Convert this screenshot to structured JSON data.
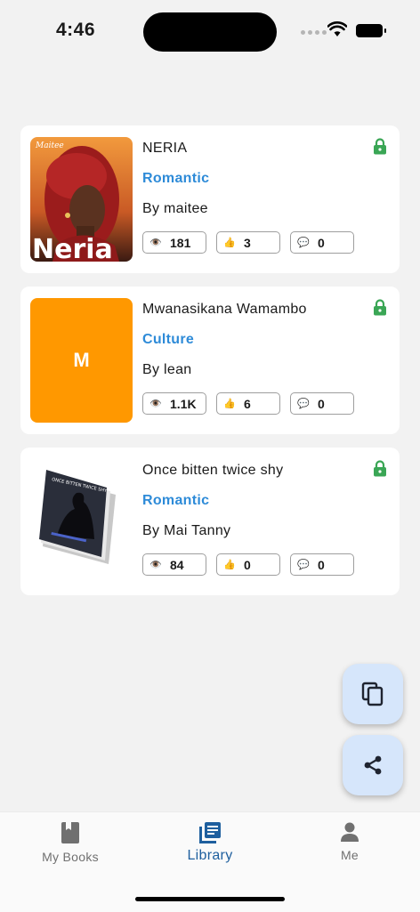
{
  "status_bar": {
    "time": "4:46"
  },
  "books": [
    {
      "title": "NERIA",
      "genre": "Romantic",
      "author": "By maitee",
      "views": "181",
      "likes": "3",
      "comments": "0",
      "cover": "image",
      "cover_top_text": "Maitee",
      "cover_bottom_text": "Neria"
    },
    {
      "title": "Mwanasikana Wamambo",
      "genre": "Culture",
      "author": "By lean",
      "views": "1.1K",
      "likes": "6",
      "comments": "0",
      "cover": "initial",
      "cover_initial": "M",
      "cover_color": "#ff9800"
    },
    {
      "title": "Once bitten twice shy",
      "genre": "Romantic",
      "author": "By Mai Tanny",
      "views": "84",
      "likes": "0",
      "comments": "0",
      "cover": "image",
      "cover_top_text": "ONCE BITTEN TWICE SHY"
    }
  ],
  "fabs": {
    "copy_icon": "copy-icon",
    "share_icon": "share-icon"
  },
  "nav": [
    {
      "label": "My Books",
      "icon": "book-icon",
      "active": false
    },
    {
      "label": "Library",
      "icon": "library-icon",
      "active": true
    },
    {
      "label": "Me",
      "icon": "person-icon",
      "active": false
    }
  ],
  "colors": {
    "accent": "#1e5f9e",
    "genre": "#2e8bd8",
    "lock": "#3aa655",
    "fab_bg": "#d6e6fb",
    "background": "#f2f2f2"
  }
}
